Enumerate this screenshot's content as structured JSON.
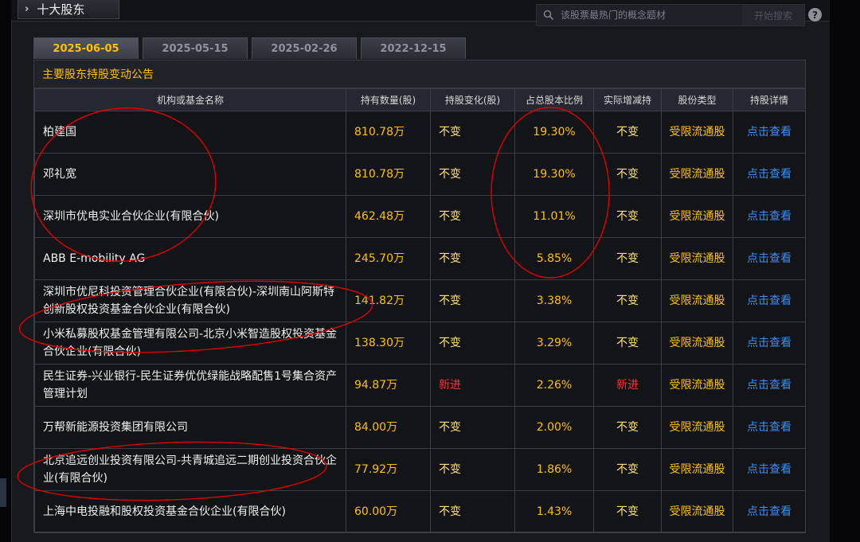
{
  "header": {
    "title": "十大股东",
    "search_placeholder": "该股票最热门的概念题材",
    "search_button": "开始搜索",
    "help": "?"
  },
  "tabs": [
    {
      "label": "2025-06-05",
      "active": true
    },
    {
      "label": "2025-05-15",
      "active": false
    },
    {
      "label": "2025-02-26",
      "active": false
    },
    {
      "label": "2022-12-15",
      "active": false
    }
  ],
  "table": {
    "caption": "主要股东持股变动公告",
    "columns": [
      "机构或基金名称",
      "持有数量(股)",
      "持股变化(股)",
      "占总股本比例",
      "实际增减持",
      "股份类型",
      "持股详情"
    ],
    "rows": [
      {
        "name": "柏建国",
        "qty": "810.78万",
        "change": "不变",
        "pct": "19.30%",
        "actual": "不变",
        "type": "受限流通股",
        "detail": "点击查看"
      },
      {
        "name": "邓礼宽",
        "qty": "810.78万",
        "change": "不变",
        "pct": "19.30%",
        "actual": "不变",
        "type": "受限流通股",
        "detail": "点击查看"
      },
      {
        "name": "深圳市优电实业合伙企业(有限合伙)",
        "qty": "462.48万",
        "change": "不变",
        "pct": "11.01%",
        "actual": "不变",
        "type": "受限流通股",
        "detail": "点击查看"
      },
      {
        "name": "ABB E-mobility AG",
        "qty": "245.70万",
        "change": "不变",
        "pct": "5.85%",
        "actual": "不变",
        "type": "受限流通股",
        "detail": "点击查看"
      },
      {
        "name": "深圳市优尼科投资管理合伙企业(有限合伙)-深圳南山阿斯特创新股权投资基金合伙企业(有限合伙)",
        "qty": "141.82万",
        "change": "不变",
        "pct": "3.38%",
        "actual": "不变",
        "type": "受限流通股",
        "detail": "点击查看"
      },
      {
        "name": "小米私募股权基金管理有限公司-北京小米智造股权投资基金合伙企业(有限合伙)",
        "qty": "138.30万",
        "change": "不变",
        "pct": "3.29%",
        "actual": "不变",
        "type": "受限流通股",
        "detail": "点击查看"
      },
      {
        "name": "民生证券-兴业银行-民生证券优优绿能战略配售1号集合资产管理计划",
        "qty": "94.87万",
        "change": "新进",
        "pct": "2.26%",
        "actual": "新进",
        "type": "受限流通股",
        "detail": "点击查看"
      },
      {
        "name": "万帮新能源投资集团有限公司",
        "qty": "84.00万",
        "change": "不变",
        "pct": "2.00%",
        "actual": "不变",
        "type": "受限流通股",
        "detail": "点击查看"
      },
      {
        "name": "北京追远创业投资有限公司-共青城追远二期创业投资合伙企业(有限合伙)",
        "qty": "77.92万",
        "change": "不变",
        "pct": "1.86%",
        "actual": "不变",
        "type": "受限流通股",
        "detail": "点击查看"
      },
      {
        "name": "上海中电投融和股权投资基金合伙企业(有限合伙)",
        "qty": "60.00万",
        "change": "不变",
        "pct": "1.43%",
        "actual": "不变",
        "type": "受限流通股",
        "detail": "点击查看"
      }
    ]
  },
  "colors": {
    "accent": "#ffc000",
    "link": "#3a8ef0",
    "new": "#ff3030",
    "annotation": "#e00000"
  }
}
